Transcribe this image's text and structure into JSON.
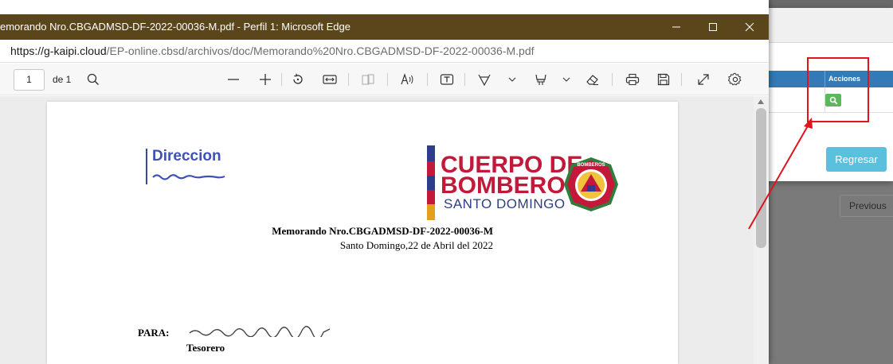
{
  "window": {
    "title": "emorando Nro.CBGADMSD-DF-2022-00036-M.pdf - Perfil 1: Microsoft Edge",
    "colors": {
      "titlebar": "#5b461b"
    }
  },
  "address_bar": {
    "url_host": "https://g-kaipi.cloud",
    "url_path": "/EP-online.cbsd/archivos/doc/Memorando%20Nro.CBGADMSD-DF-2022-00036-M.pdf"
  },
  "pdf_toolbar": {
    "page_number": "1",
    "page_of": "de 1",
    "icons": [
      "search-icon",
      "zoom-out-icon",
      "zoom-in-icon",
      "rotate-icon",
      "fit-width-icon",
      "two-page-icon",
      "read-aloud-icon",
      "text-icon",
      "draw-icon",
      "chevron-down-icon",
      "highlight-icon",
      "chevron-down-icon",
      "eraser-icon",
      "print-icon",
      "save-icon",
      "fullscreen-icon",
      "settings-icon"
    ]
  },
  "document": {
    "department": "Direccion",
    "logo": {
      "line1": "CUERPO DE",
      "line2": "BOMBEROS",
      "line3": "SANTO DOMINGO",
      "emblem_text": "BOMBEROS"
    },
    "memo_number": "Memorando Nro.CBGADMSD-DF-2022-00036-M",
    "memo_date": "Santo Domingo,22 de Abril del 2022",
    "para_label": "PARA:",
    "para_role": "Tesorero"
  },
  "background_app": {
    "table_header_acciones": "Acciones",
    "regresar_label": "Regresar",
    "previous_label": "Previous",
    "colors": {
      "header": "#337ab7",
      "search_button": "#5cb85c",
      "regresar": "#5bc0de",
      "annotation": "#e0141e"
    }
  }
}
